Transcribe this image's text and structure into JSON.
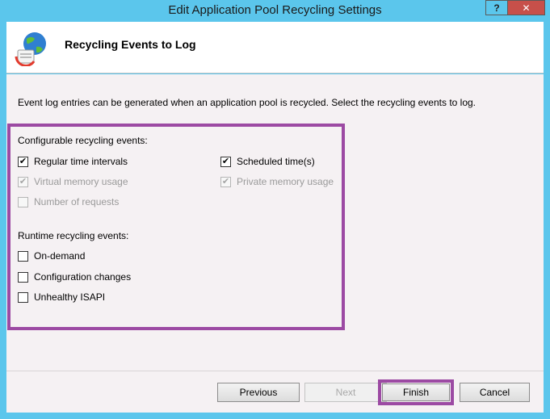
{
  "window": {
    "title": "Edit Application Pool Recycling Settings",
    "help_glyph": "?",
    "close_glyph": "✕"
  },
  "header": {
    "title": "Recycling Events to Log",
    "icon": "globe-recycle-icon"
  },
  "description": "Event log entries can be generated when an application pool is recycled. Select the recycling events to log.",
  "configurable": {
    "label": "Configurable recycling events:",
    "items": [
      {
        "label": "Regular time intervals",
        "checked": true,
        "enabled": true
      },
      {
        "label": "Virtual memory usage",
        "checked": true,
        "enabled": false
      },
      {
        "label": "Number of requests",
        "checked": false,
        "enabled": false
      },
      {
        "label": "Scheduled time(s)",
        "checked": true,
        "enabled": true
      },
      {
        "label": "Private memory usage",
        "checked": true,
        "enabled": false
      }
    ]
  },
  "runtime": {
    "label": "Runtime recycling events:",
    "items": [
      {
        "label": "On-demand",
        "checked": false,
        "enabled": true
      },
      {
        "label": "Configuration changes",
        "checked": false,
        "enabled": true
      },
      {
        "label": "Unhealthy ISAPI",
        "checked": false,
        "enabled": true
      }
    ]
  },
  "buttons": {
    "previous": "Previous",
    "next": "Next",
    "finish": "Finish",
    "cancel": "Cancel"
  },
  "colors": {
    "titlebar": "#5bc6ec",
    "close": "#c7504a",
    "highlight": "#9c4aa3"
  }
}
